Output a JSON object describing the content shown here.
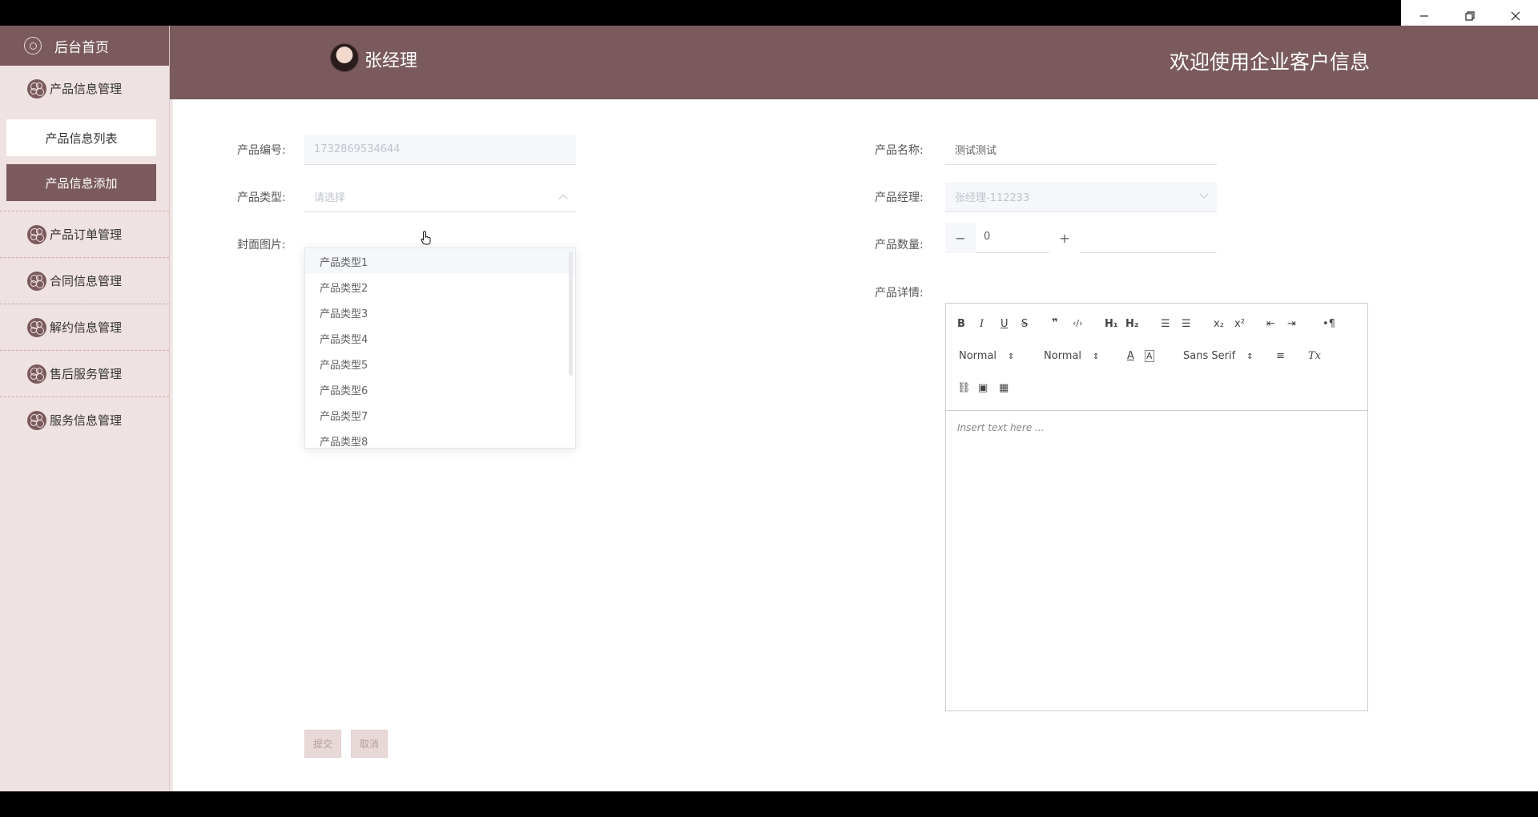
{
  "window": {
    "minimize": "—",
    "restore": "❐",
    "close": "✕"
  },
  "sidebar": {
    "home": "后台首页",
    "groups": [
      {
        "label": "产品信息管理",
        "subs": [
          {
            "label": "产品信息列表"
          },
          {
            "label": "产品信息添加"
          }
        ]
      },
      {
        "label": "产品订单管理"
      },
      {
        "label": "合同信息管理"
      },
      {
        "label": "解约信息管理"
      },
      {
        "label": "售后服务管理"
      },
      {
        "label": "服务信息管理"
      }
    ]
  },
  "header": {
    "username": "张经理",
    "welcome": "欢迎使用企业客户信息"
  },
  "form": {
    "code_label": "产品编号:",
    "code_value": "1732869534644",
    "name_label": "产品名称:",
    "name_value": "测试测试",
    "type_label": "产品类型:",
    "type_placeholder": "请选择",
    "manager_label": "产品经理:",
    "manager_value": "张经理-112233",
    "cover_label": "封面图片:",
    "qty_label": "产品数量:",
    "qty_value": "0",
    "qty_minus": "−",
    "qty_plus": "+",
    "detail_label": "产品详情:",
    "submit": "提交",
    "cancel": "取消"
  },
  "dropdown": {
    "options": [
      "产品类型1",
      "产品类型2",
      "产品类型3",
      "产品类型4",
      "产品类型5",
      "产品类型6",
      "产品类型7",
      "产品类型8"
    ]
  },
  "editor": {
    "placeholder": "Insert text here ...",
    "toolbar": {
      "bold": "B",
      "italic": "I",
      "underline": "U",
      "strike": "S",
      "quote": "❞",
      "code": "‹/›",
      "h1": "H₁",
      "h2": "H₂",
      "ol": "☰",
      "ul": "☰",
      "sub": "x₂",
      "sup": "x²",
      "outdent": "⇤",
      "indent": "⇥",
      "direction": "•¶",
      "size_select": "Normal",
      "header_select": "Normal",
      "font_select": "Sans Serif",
      "color": "A",
      "background": "A",
      "align": "≡",
      "clean": "Tx",
      "link": "⛓",
      "image": "▣",
      "video": "▦"
    }
  }
}
